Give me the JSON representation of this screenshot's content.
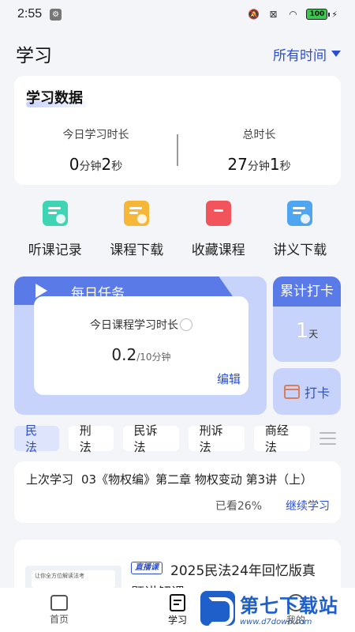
{
  "status": {
    "time": "2:55",
    "battery": "100"
  },
  "header": {
    "title": "学习",
    "filter": "所有时间"
  },
  "stats": {
    "title": "学习数据",
    "today": {
      "label": "今日学习时长",
      "min_num": "0",
      "min_unit": "分钟",
      "sec_num": "2",
      "sec_unit": "秒"
    },
    "total": {
      "label": "总时长",
      "min_num": "27",
      "min_unit": "分钟",
      "sec_num": "1",
      "sec_unit": "秒"
    }
  },
  "shortcuts": [
    {
      "label": "听课记录",
      "color": "#3fd4b4"
    },
    {
      "label": "课程下载",
      "color": "#f6b638"
    },
    {
      "label": "收藏课程",
      "color": "#f2545b"
    },
    {
      "label": "讲义下载",
      "color": "#4fa5f0"
    }
  ],
  "daily_task": {
    "title": "每日任务",
    "task_name": "今日课程学习时长",
    "progress_value": "0.2",
    "progress_target": "/10分钟",
    "edit_label": "编辑"
  },
  "checkin": {
    "total_label": "累计打卡",
    "days": "1",
    "days_unit": "天",
    "button_label": "打卡"
  },
  "categories": [
    {
      "label": "民法",
      "active": true
    },
    {
      "label": "刑法",
      "active": false
    },
    {
      "label": "民诉法",
      "active": false
    },
    {
      "label": "刑诉法",
      "active": false
    },
    {
      "label": "商经法",
      "active": false
    }
  ],
  "last_study": {
    "label": "上次学习",
    "course": "03《物权编》第二章 物权变动 第3讲（上）",
    "watched": "已看26%",
    "continue_label": "继续学习"
  },
  "course_card": {
    "badge": "直播课",
    "title_line1": "2025民法24年回忆版真",
    "title_line2": "题讲解课",
    "thumb_text": "让你全方位解读法考"
  },
  "bottom_nav": [
    {
      "label": "首页"
    },
    {
      "label": "学习"
    },
    {
      "label": "我的"
    }
  ],
  "watermark": {
    "cn": "第七下载站",
    "url": "www.d7down.com"
  }
}
